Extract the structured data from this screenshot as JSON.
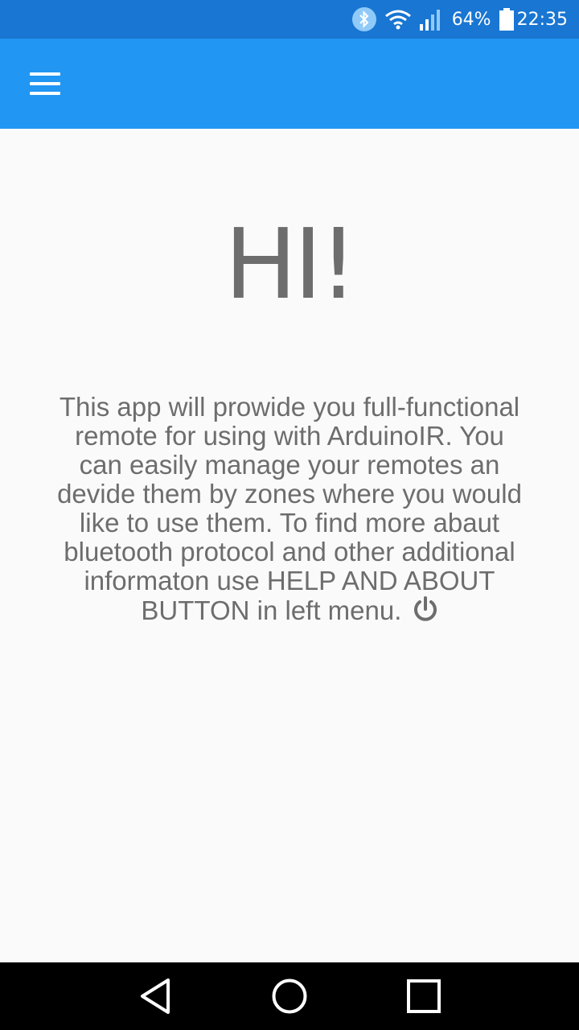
{
  "status_bar": {
    "battery_percent": "64%",
    "time": "22:35",
    "icons": [
      "bluetooth-icon",
      "wifi-icon",
      "signal-icon",
      "battery-icon"
    ]
  },
  "app_bar": {
    "menu_icon": "hamburger-menu-icon",
    "color": "#2196f3"
  },
  "content": {
    "greeting": "HI!",
    "intro_text": "This app will prowide you full-functional remote for using with ArduinoIR. You can easily manage your remotes an devide them by zones where you would like to use them. To find more abaut bluetooth protocol and other additional informaton use HELP AND ABOUT BUTTON in left menu.",
    "trailing_icon": "power-icon"
  },
  "nav_bar": {
    "buttons": [
      "back-icon",
      "home-icon",
      "recents-icon"
    ]
  },
  "colors": {
    "status_bar": "#1976d2",
    "app_bar": "#2196f3",
    "text": "#6d6d6d",
    "background": "#fafafa"
  }
}
